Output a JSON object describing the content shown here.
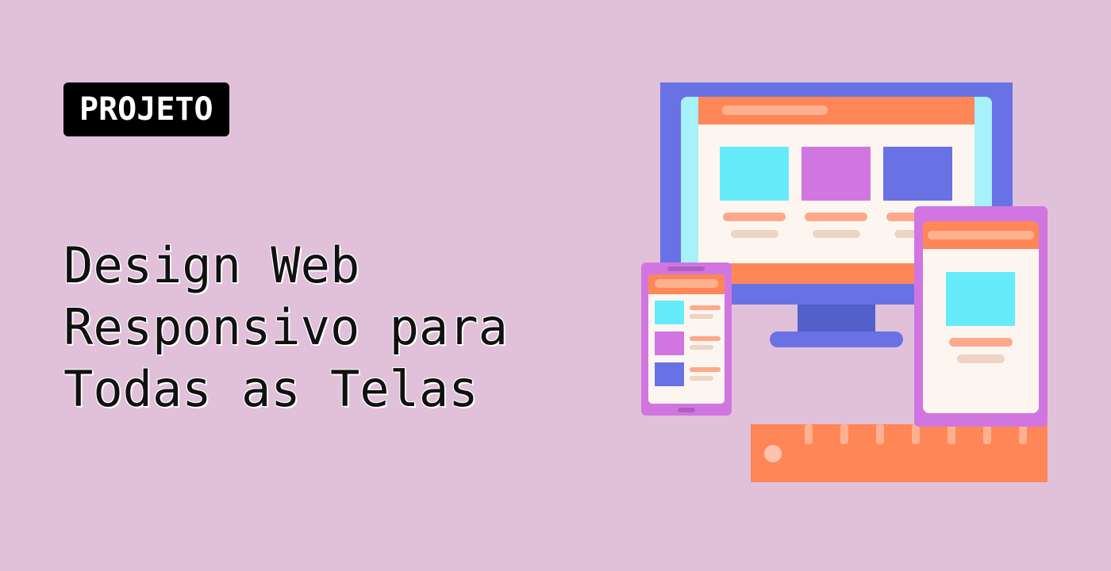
{
  "badge": {
    "label": "PROJETO"
  },
  "title": {
    "lines": [
      "Design Web",
      "Responsivo para",
      "Todas as Telas"
    ]
  },
  "colors": {
    "background": "#e0c1d9",
    "badge_bg": "#000000",
    "badge_text": "#ffffff",
    "title_text": "#111111",
    "monitor_frame": "#6872e5",
    "screen_bezel": "#a6f1fa",
    "header_orange": "#ff8657",
    "page_bg": "#fdf6f0",
    "card_cyan": "#66ebfa",
    "card_purple": "#d176e0",
    "card_blue": "#6872e5",
    "text_salmon": "#ffa88a",
    "text_beige": "#efd3c4",
    "monitor_stand": "#5460c9",
    "device_purple": "#d176e0",
    "ruler_orange": "#ff8657",
    "ruler_ticks": "#ffb18f"
  },
  "illustration": {
    "icons": [
      "desktop-monitor-icon",
      "smartphone-icon",
      "tablet-icon",
      "ruler-icon"
    ]
  }
}
